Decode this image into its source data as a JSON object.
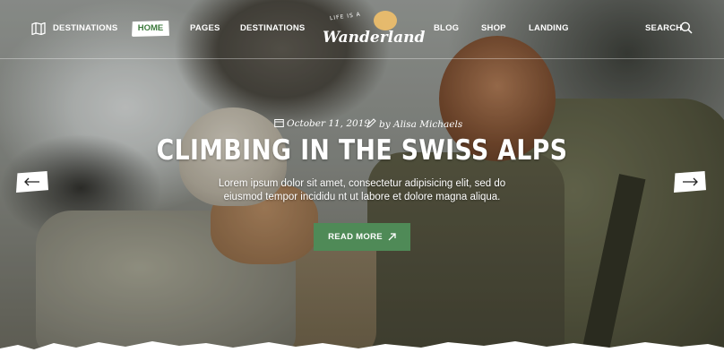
{
  "nav": {
    "destinations_left": "DESTINATIONS",
    "home": "HOME",
    "pages": "PAGES",
    "destinations": "DESTINATIONS",
    "blog": "BLOG",
    "shop": "SHOP",
    "landing": "LANDING",
    "search": "SEARCH"
  },
  "logo": {
    "tagline": "LIFE IS A",
    "name": "Wanderland"
  },
  "post": {
    "date": "October 11, 2019",
    "author": "by Alisa Michaels",
    "title": "CLIMBING IN THE SWISS ALPS",
    "excerpt": "Lorem ipsum dolor sit amet, consectetur adipisicing elit, sed do eiusmod tempor incididu nt ut labore et dolore magna aliqua.",
    "read_more": "READ MORE"
  },
  "colors": {
    "accent": "#4f8a57",
    "home_text": "#3c7a3c"
  },
  "icons": [
    "map-icon",
    "search-icon",
    "calendar-icon",
    "pen-icon",
    "arrow-up-right-icon",
    "arrow-left-icon",
    "arrow-right-icon"
  ]
}
